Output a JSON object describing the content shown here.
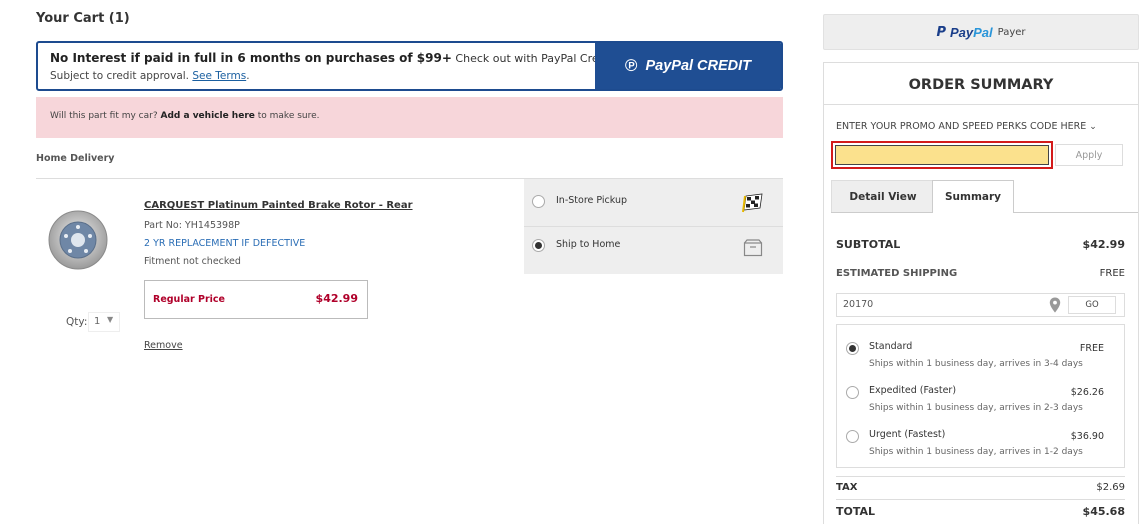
{
  "cart": {
    "title": "Your Cart (1)",
    "home_delivery_label": "Home Delivery"
  },
  "paypal_banner": {
    "headline": "No Interest if paid in full in 6 months on purchases of $99+",
    "headline_suffix": "Check out with PayPal Credit",
    "sub": "Subject to credit approval.",
    "terms_link": "See Terms",
    "terms_suffix": ".",
    "credit_logo": "PayPal CREDIT"
  },
  "fit_bar": {
    "prefix": "Will this part fit my car?",
    "link": "Add a vehicle here",
    "suffix": "to make sure."
  },
  "item": {
    "name": "CARQUEST Platinum Painted Brake Rotor - Rear",
    "part_no": "Part No: YH145398P",
    "warranty": "2 YR REPLACEMENT IF DEFECTIVE",
    "fitment": "Fitment not checked",
    "price_label": "Regular Price",
    "price": "$42.99",
    "qty_label": "Qty:",
    "qty_value": "1",
    "remove": "Remove"
  },
  "fulfillment": {
    "options": [
      {
        "label": "In-Store Pickup",
        "selected": false,
        "icon": "checkered-flag-icon"
      },
      {
        "label": "Ship to Home",
        "selected": true,
        "icon": "box-icon"
      }
    ]
  },
  "paypal_payer": {
    "logo_pay": "Pay",
    "logo_pal": "Pal",
    "label": "Payer"
  },
  "summary": {
    "title": "ORDER SUMMARY",
    "promo_label": "ENTER YOUR PROMO AND SPEED PERKS CODE HERE",
    "promo_value": "",
    "apply": "Apply",
    "tabs": [
      "Detail View",
      "Summary"
    ],
    "active_tab": "Summary",
    "subtotal_label": "SUBTOTAL",
    "subtotal": "$42.99",
    "shipping_label": "ESTIMATED SHIPPING",
    "shipping": "FREE",
    "zip": "20170",
    "go": "GO",
    "ship_options": [
      {
        "name": "Standard",
        "price": "FREE",
        "desc": "Ships within 1 business day, arrives in 3-4 days",
        "selected": true
      },
      {
        "name": "Expedited (Faster)",
        "price": "$26.26",
        "desc": "Ships within 1 business day, arrives in 2-3 days",
        "selected": false
      },
      {
        "name": "Urgent (Fastest)",
        "price": "$36.90",
        "desc": "Ships within 1 business day, arrives in 1-2 days",
        "selected": false
      }
    ],
    "tax_label": "TAX",
    "tax": "$2.69",
    "total_label": "TOTAL",
    "total": "$45.68"
  },
  "colors": {
    "paypal_blue": "#1f4e93",
    "fit_bar_bg": "#f7d6da",
    "price_red": "#b0002a",
    "promo_highlight": "#fbe18d",
    "promo_border": "#d31a1a"
  }
}
